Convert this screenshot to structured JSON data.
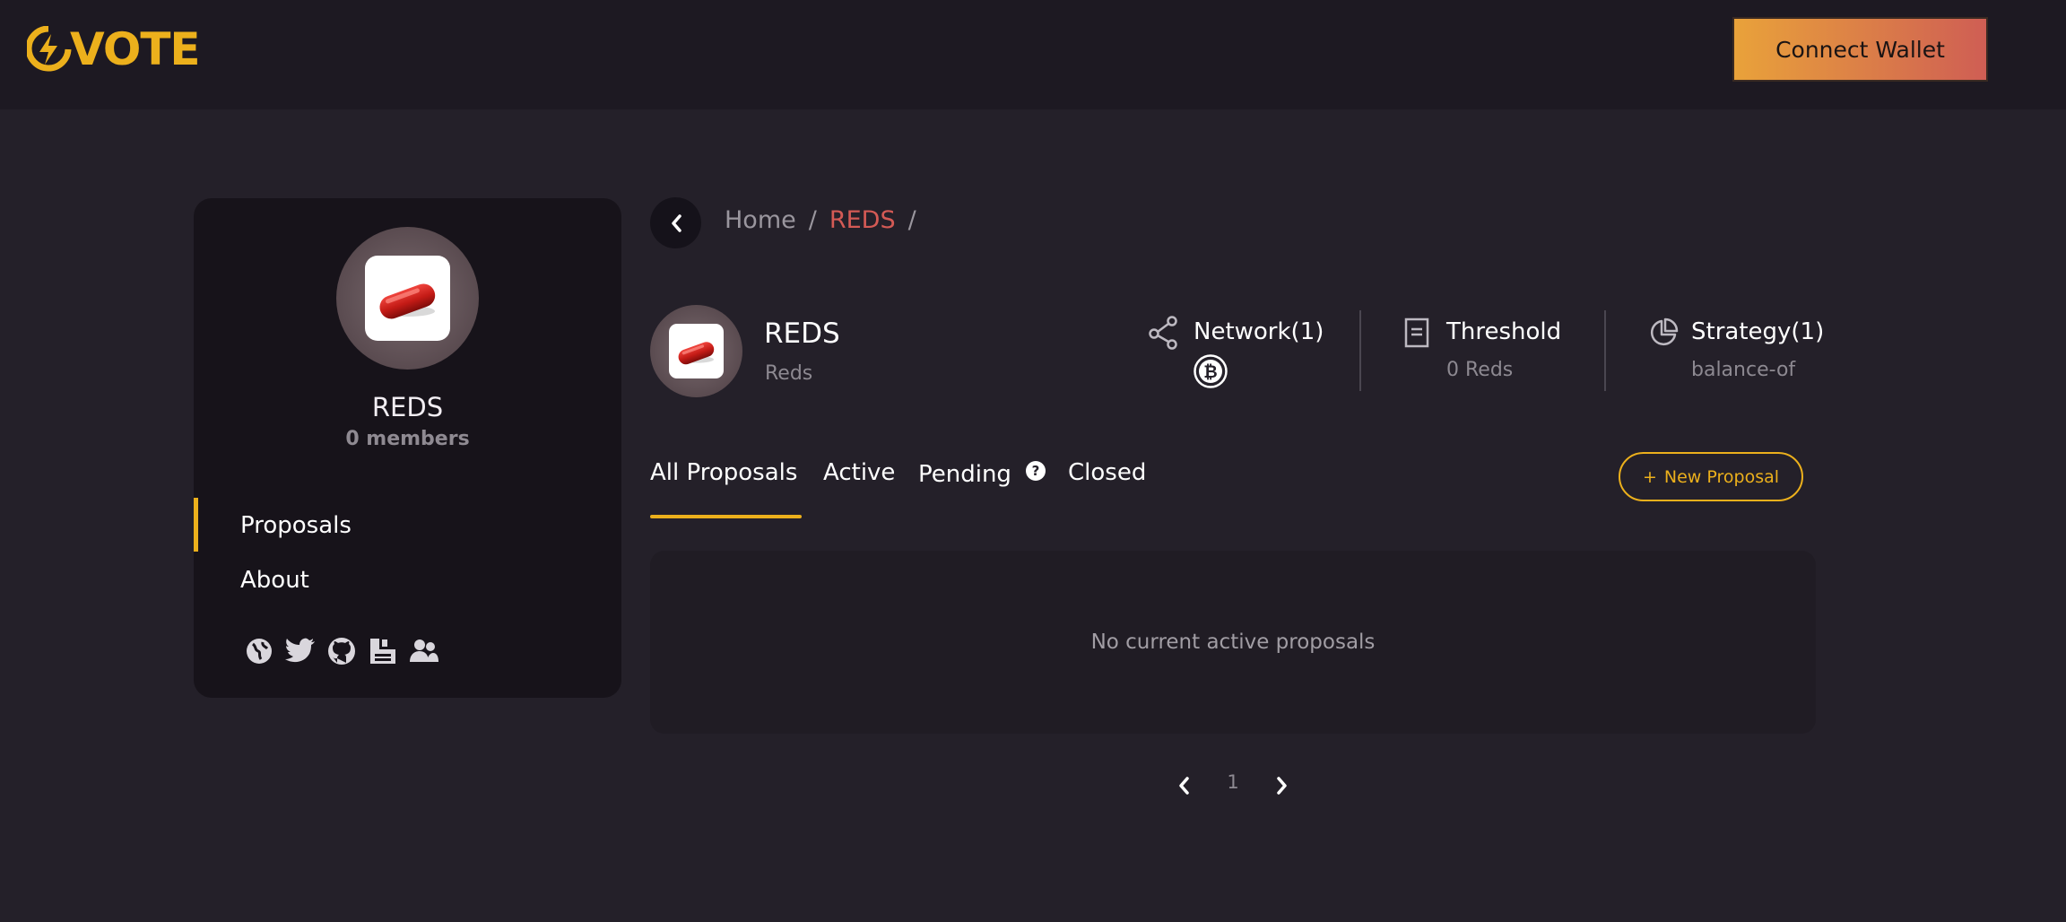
{
  "header": {
    "logo_text": "VOTE",
    "connect_wallet_label": "Connect Wallet",
    "logo_color": "#ecb01c",
    "button_gradient": [
      "#e9a23a",
      "#cf5e54"
    ]
  },
  "sidebar": {
    "space_name": "REDS",
    "members": "0 members",
    "nav": [
      {
        "label": "Proposals",
        "active": true
      },
      {
        "label": "About",
        "active": false
      }
    ],
    "socials": [
      "globe-icon",
      "twitter-icon",
      "github-icon",
      "docs-icon",
      "community-icon"
    ]
  },
  "breadcrumb": {
    "home": "Home",
    "separator": "/",
    "current": "REDS",
    "current_color": "#d45a55"
  },
  "space": {
    "name": "REDS",
    "symbol": "Reds",
    "network": {
      "label": "Network(1)",
      "icon": "bitcoin-icon"
    },
    "threshold": {
      "label": "Threshold",
      "value": "0 Reds"
    },
    "strategy": {
      "label": "Strategy(1)",
      "value": "balance-of"
    }
  },
  "tabs": [
    {
      "label": "All Proposals",
      "active": true
    },
    {
      "label": "Active",
      "active": false
    },
    {
      "label": "Pending",
      "active": false,
      "help": "?"
    },
    {
      "label": "Closed",
      "active": false
    }
  ],
  "new_proposal_label": "New Proposal",
  "new_proposal_icon": "+",
  "empty_state": "No current active proposals",
  "pagination": {
    "current_page": "1"
  }
}
